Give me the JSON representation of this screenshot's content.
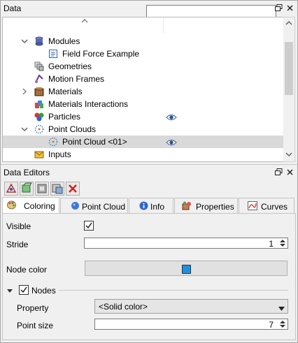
{
  "data_panel": {
    "title": "Data",
    "search_placeholder": "",
    "tree_items": [
      {
        "label": "Modules",
        "expanded": true,
        "icon": "database-icon"
      },
      {
        "label": "Field Force Example",
        "icon": "document-icon"
      },
      {
        "label": "Geometries",
        "icon": "geometries-icon"
      },
      {
        "label": "Motion Frames",
        "icon": "motion-frames-icon"
      },
      {
        "label": "Materials",
        "expanded": false,
        "icon": "materials-icon"
      },
      {
        "label": "Materials Interactions",
        "icon": "materials-interactions-icon"
      },
      {
        "label": "Particles",
        "icon": "particles-icon",
        "visible": true
      },
      {
        "label": "Point Clouds",
        "expanded": true,
        "icon": "point-clouds-icon"
      },
      {
        "label": "Point Cloud <01>",
        "icon": "point-cloud-icon",
        "visible": true,
        "selected": true
      },
      {
        "label": "Inputs",
        "icon": "inputs-icon"
      }
    ]
  },
  "editors_panel": {
    "title": "Data Editors",
    "toolbar_icons": [
      "editor-tool-1-icon",
      "editor-tool-2-icon",
      "editor-tool-3-icon",
      "editor-tool-4-icon",
      "delete-icon"
    ],
    "tabs": [
      {
        "label": "Coloring",
        "active": true,
        "icon": "palette-icon"
      },
      {
        "label": "Point Cloud",
        "icon": "point-cloud-tab-icon"
      },
      {
        "label": "Info",
        "icon": "info-icon"
      },
      {
        "label": "Properties",
        "icon": "properties-icon"
      },
      {
        "label": "Curves",
        "icon": "curves-icon"
      }
    ],
    "coloring": {
      "visible_label": "Visible",
      "visible_checked": true,
      "stride_label": "Stride",
      "stride_value": "1",
      "node_color_label": "Node color",
      "node_color": "#1e90e0",
      "nodes_label": "Nodes",
      "nodes_checked": true,
      "property_label": "Property",
      "property_value": "<Solid color>",
      "point_size_label": "Point size",
      "point_size_value": "7"
    }
  },
  "colors": {
    "selection": "#d9d9d9",
    "eye": "#4a6fa5",
    "delete": "#d42020"
  }
}
